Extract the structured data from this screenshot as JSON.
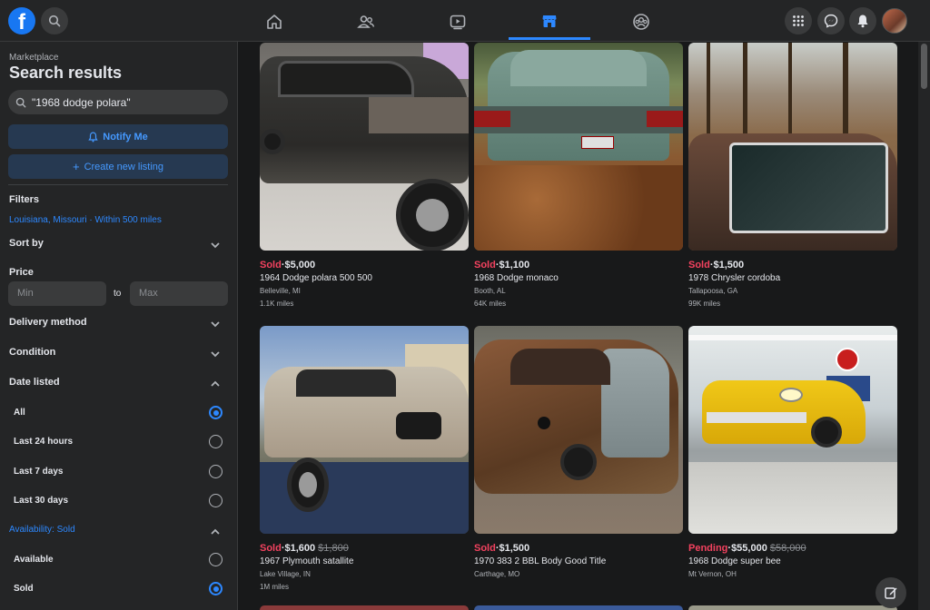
{
  "topbar": {
    "logo_letter": "f",
    "nav_tabs": [
      "home",
      "friends",
      "watch",
      "marketplace",
      "groups"
    ],
    "active_tab": "marketplace"
  },
  "sidebar": {
    "breadcrumb": "Marketplace",
    "title": "Search results",
    "search_value": "\"1968 dodge polara\"",
    "notify_label": "Notify Me",
    "create_label": "Create new listing",
    "filters_label": "Filters",
    "location": "Louisiana, Missouri · Within 500 miles",
    "sort_by": "Sort by",
    "price_label": "Price",
    "min_placeholder": "Min",
    "to_label": "to",
    "max_placeholder": "Max",
    "delivery_method": "Delivery method",
    "condition": "Condition",
    "date_listed": "Date listed",
    "date_options": [
      "All",
      "Last 24 hours",
      "Last 7 days",
      "Last 30 days"
    ],
    "date_selected": "All",
    "availability_label": "Availability: Sold",
    "availability_options": [
      "Available",
      "Sold"
    ],
    "availability_selected": "Sold"
  },
  "listings": [
    {
      "status": "Sold",
      "price": "$5,000",
      "old_price": "",
      "title": "1964 Dodge polara 500 500",
      "location": "Belleville, MI",
      "miles": "1.1K miles"
    },
    {
      "status": "Sold",
      "price": "$1,100",
      "old_price": "",
      "title": "1968 Dodge monaco",
      "location": "Booth, AL",
      "miles": "64K miles"
    },
    {
      "status": "Sold",
      "price": "$1,500",
      "old_price": "",
      "title": "1978 Chrysler cordoba",
      "location": "Tallapoosa, GA",
      "miles": "99K miles"
    },
    {
      "status": "Sold",
      "price": "$1,600",
      "old_price": "$1,800",
      "title": "1967 Plymouth satallite",
      "location": "Lake Village, IN",
      "miles": "1M miles"
    },
    {
      "status": "Sold",
      "price": "$1,500",
      "old_price": "",
      "title": "1970 383 2 BBL Body Good Title",
      "location": "Carthage, MO",
      "miles": ""
    },
    {
      "status": "Pending",
      "price": "$55,000",
      "old_price": "$58,000",
      "title": "1968 Dodge super bee",
      "location": "Mt Vernon, OH",
      "miles": ""
    }
  ],
  "separator": "·",
  "colors": {
    "accent": "#2d88ff",
    "sold": "#f3425f",
    "background": "#18191a",
    "surface": "#242526"
  }
}
